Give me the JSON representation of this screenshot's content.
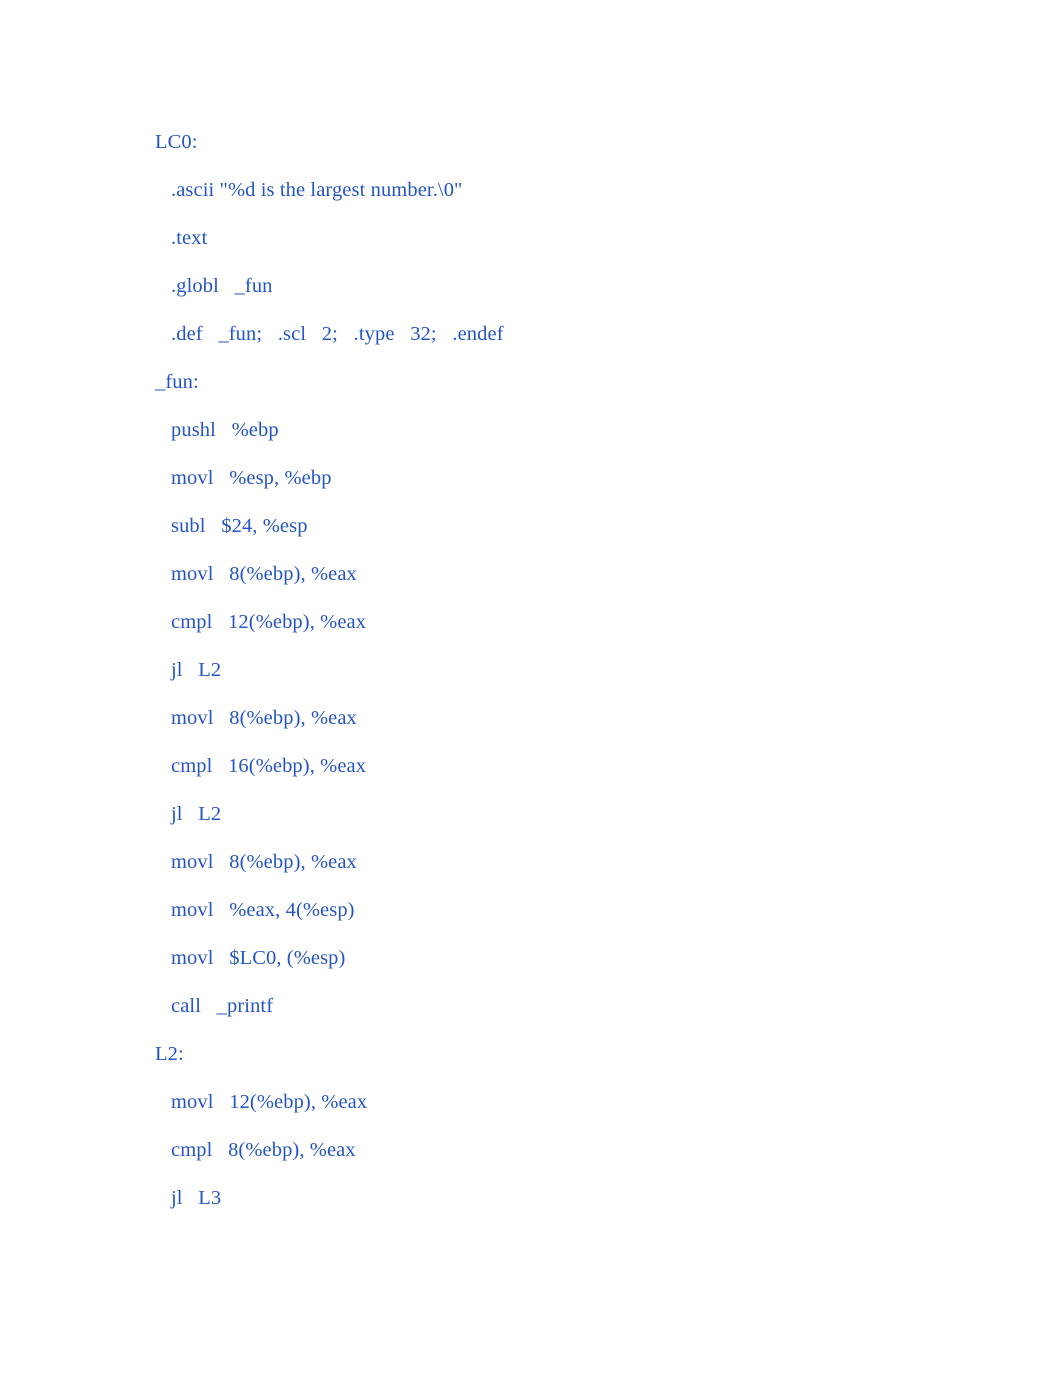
{
  "document": {
    "kind": "assembly-source-listing",
    "background_color": "#ffffff",
    "text_color": "#2455C4",
    "lines": [
      {
        "text": "LC0:",
        "indent": 0,
        "kind": "label"
      },
      {
        "text": ".ascii \"%d is the largest number.\\0\"",
        "indent": 1,
        "kind": "directive"
      },
      {
        "text": ".text",
        "indent": 1,
        "kind": "directive"
      },
      {
        "text": ".globl   _fun",
        "indent": 1,
        "kind": "directive"
      },
      {
        "text": ".def   _fun;   .scl   2;   .type   32;   .endef",
        "indent": 1,
        "kind": "directive"
      },
      {
        "text": "_fun:",
        "indent": 0,
        "kind": "label"
      },
      {
        "text": "pushl   %ebp",
        "indent": 1,
        "kind": "instruction"
      },
      {
        "text": "movl   %esp, %ebp",
        "indent": 1,
        "kind": "instruction"
      },
      {
        "text": "subl   $24, %esp",
        "indent": 1,
        "kind": "instruction"
      },
      {
        "text": "movl   8(%ebp), %eax",
        "indent": 1,
        "kind": "instruction"
      },
      {
        "text": "cmpl   12(%ebp), %eax",
        "indent": 1,
        "kind": "instruction"
      },
      {
        "text": "jl   L2",
        "indent": 1,
        "kind": "instruction"
      },
      {
        "text": "movl   8(%ebp), %eax",
        "indent": 1,
        "kind": "instruction"
      },
      {
        "text": "cmpl   16(%ebp), %eax",
        "indent": 1,
        "kind": "instruction"
      },
      {
        "text": "jl   L2",
        "indent": 1,
        "kind": "instruction"
      },
      {
        "text": "movl   8(%ebp), %eax",
        "indent": 1,
        "kind": "instruction"
      },
      {
        "text": "movl   %eax, 4(%esp)",
        "indent": 1,
        "kind": "instruction"
      },
      {
        "text": "movl   $LC0, (%esp)",
        "indent": 1,
        "kind": "instruction"
      },
      {
        "text": "call   _printf",
        "indent": 1,
        "kind": "instruction"
      },
      {
        "text": "L2:",
        "indent": 0,
        "kind": "label"
      },
      {
        "text": "movl   12(%ebp), %eax",
        "indent": 1,
        "kind": "instruction"
      },
      {
        "text": "cmpl   8(%ebp), %eax",
        "indent": 1,
        "kind": "instruction"
      },
      {
        "text": "jl   L3",
        "indent": 1,
        "kind": "instruction"
      }
    ]
  }
}
